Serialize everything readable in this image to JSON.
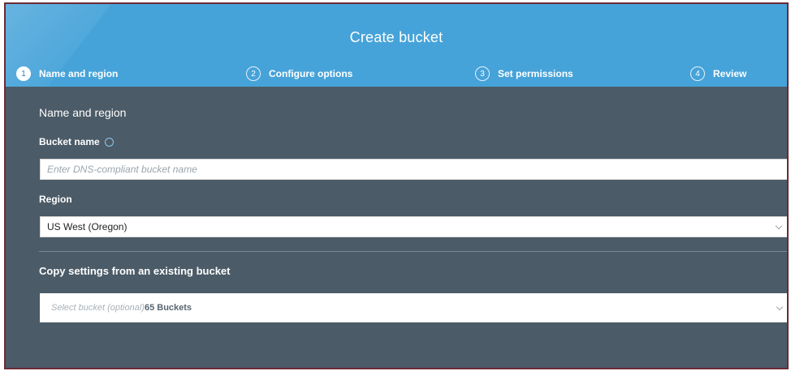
{
  "dialog": {
    "title": "Create bucket"
  },
  "steps": [
    {
      "number": "1",
      "label": "Name and region",
      "active": true
    },
    {
      "number": "2",
      "label": "Configure options",
      "active": false
    },
    {
      "number": "3",
      "label": "Set permissions",
      "active": false
    },
    {
      "number": "4",
      "label": "Review",
      "active": false
    }
  ],
  "section": {
    "title": "Name and region"
  },
  "bucket_name": {
    "label": "Bucket name",
    "placeholder": "Enter DNS-compliant bucket name",
    "value": ""
  },
  "region": {
    "label": "Region",
    "selected": "US West (Oregon)"
  },
  "copy_settings": {
    "title": "Copy settings from an existing bucket",
    "placeholder": "Select bucket (optional)",
    "count_text": "65 Buckets"
  },
  "icons": {
    "info": "info-icon",
    "chevron": "chevron-down-icon"
  },
  "colors": {
    "header": "#46a3d9",
    "panel": "#4b5b67",
    "frame_border": "#6b2b35",
    "field_background": "#ffffff"
  }
}
